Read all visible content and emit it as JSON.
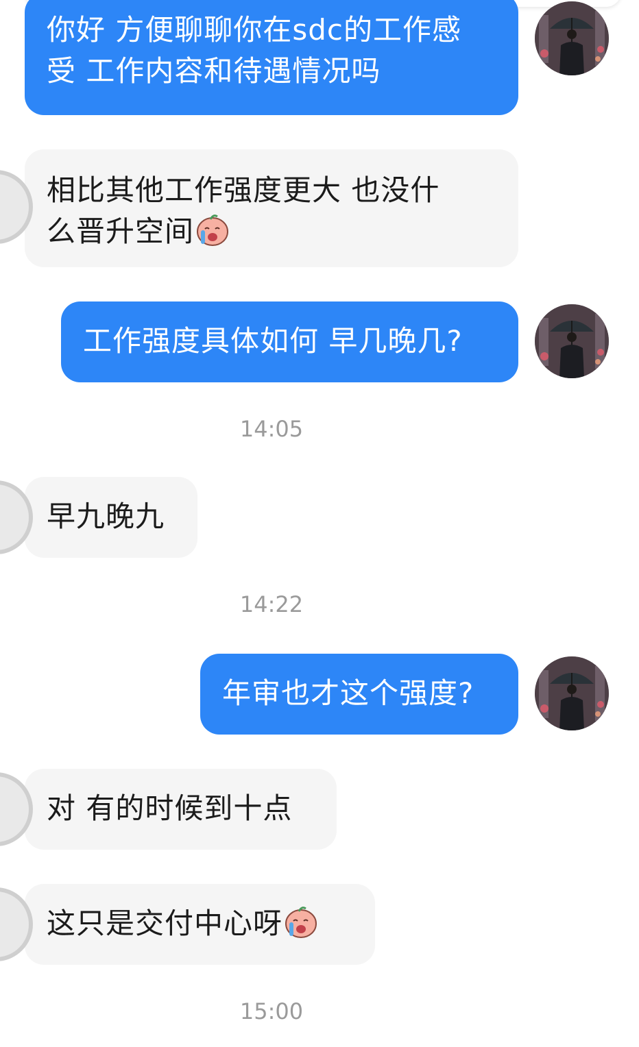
{
  "conversation": {
    "messages": [
      {
        "direction": "out",
        "text": "你好 方便聊聊你在sdc的工作感\n受 工作内容和待遇情况吗"
      },
      {
        "direction": "in",
        "text": "相比其他工作强度更大 也没什\n么晋升空间",
        "emoji": "crying-face-emoji"
      },
      {
        "direction": "out",
        "text": "工作强度具体如何 早几晚几?"
      },
      {
        "type": "time",
        "text": "14:05"
      },
      {
        "direction": "in",
        "text": "早九晚九"
      },
      {
        "type": "time",
        "text": "14:22"
      },
      {
        "direction": "out",
        "text": "年审也才这个强度?"
      },
      {
        "direction": "in",
        "text": "对 有的时候到十点"
      },
      {
        "direction": "in",
        "text": "这只是交付中心呀",
        "emoji": "crying-face-emoji"
      },
      {
        "type": "time",
        "text": "15:00"
      }
    ]
  },
  "colors": {
    "outgoing_bubble": "#2d86f7",
    "incoming_bubble": "#f5f5f5",
    "timestamp": "#9a9a9a"
  }
}
